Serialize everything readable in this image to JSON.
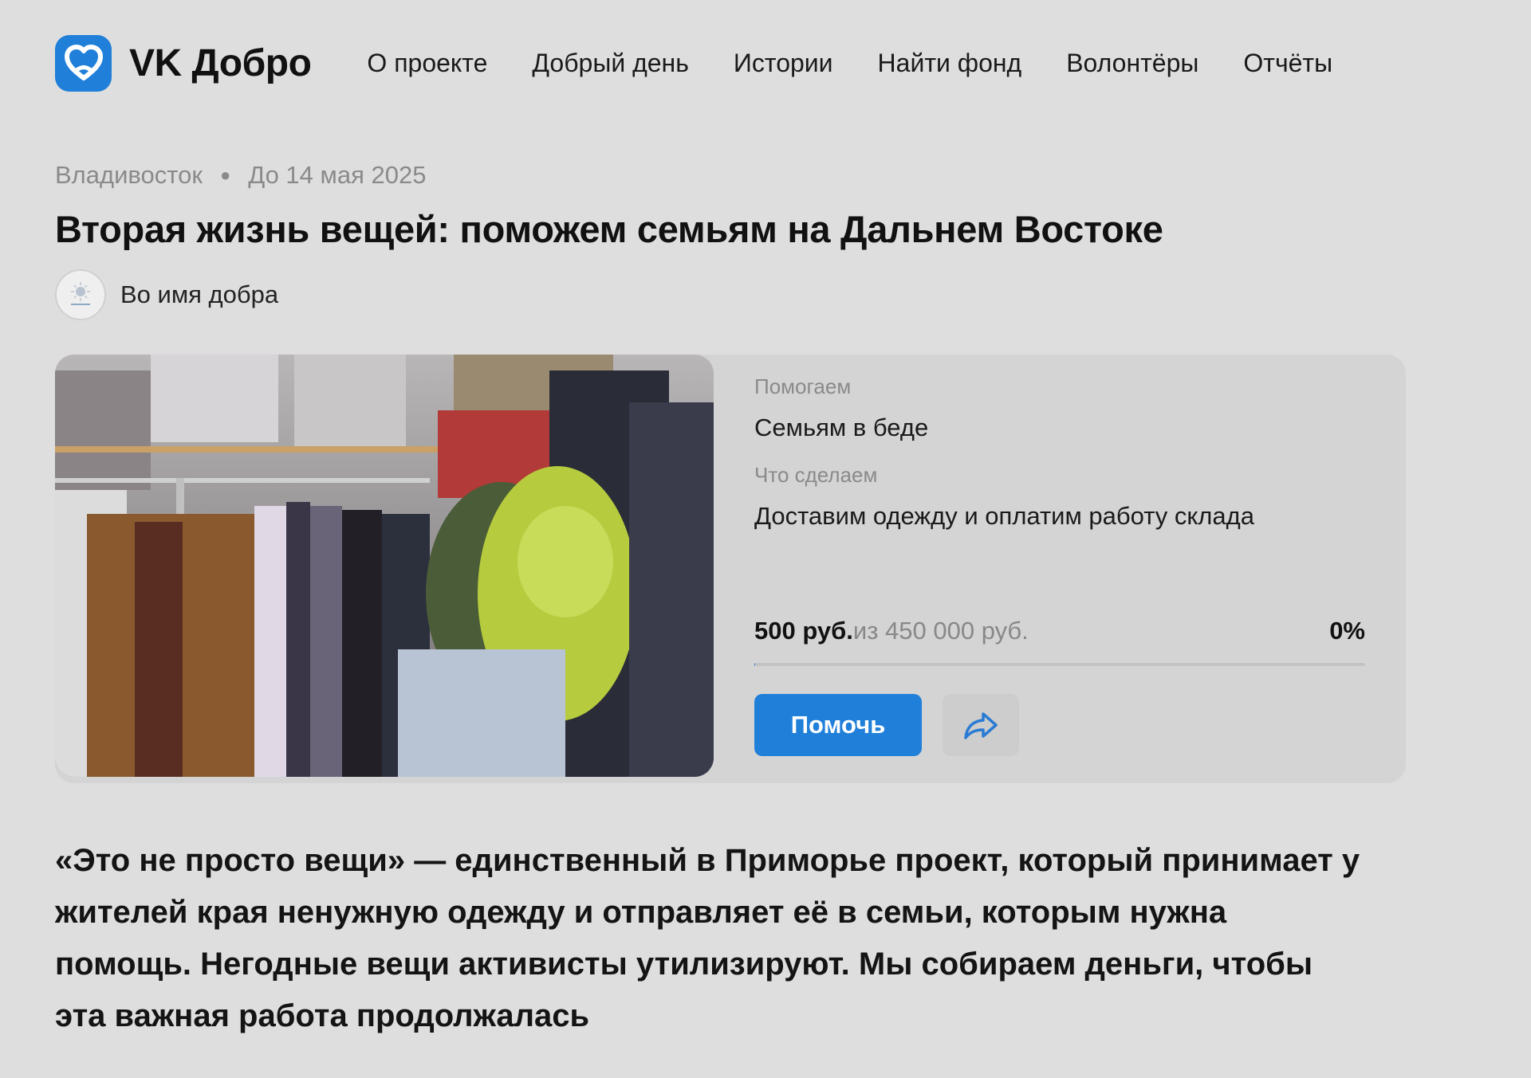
{
  "header": {
    "logo_text": "VK Добро",
    "nav": [
      "О проекте",
      "Добрый день",
      "Истории",
      "Найти фонд",
      "Волонтёры",
      "Отчёты"
    ]
  },
  "meta": {
    "city": "Владивосток",
    "deadline": "До 14 мая 2025"
  },
  "title": "Вторая жизнь вещей: поможем семьям на Дальнем Востоке",
  "organization": {
    "name": "Во имя добра"
  },
  "card": {
    "help_label": "Помогаем",
    "help_value": "Семьям в беде",
    "do_label": "Что сделаем",
    "do_value": "Доставим одежду и оплатим работу склада",
    "raised": "500 руб.",
    "goal": "из 450 000 руб.",
    "percent": "0%",
    "progress_fraction": 0.0011,
    "help_button": "Помочь"
  },
  "lead": "«Это не просто вещи» — единственный в Приморье проект, который принимает у жителей края ненужную одежду и отправляет её в семьи, которым нужна помощь. Негодные вещи активисты утилизируют. Мы собираем деньги, чтобы эта важная работа продолжалась",
  "colors": {
    "accent": "#1f7fd9",
    "background": "#dedede"
  },
  "icons": {
    "logo": "heart-logo-icon",
    "share": "share-arrow-icon"
  }
}
